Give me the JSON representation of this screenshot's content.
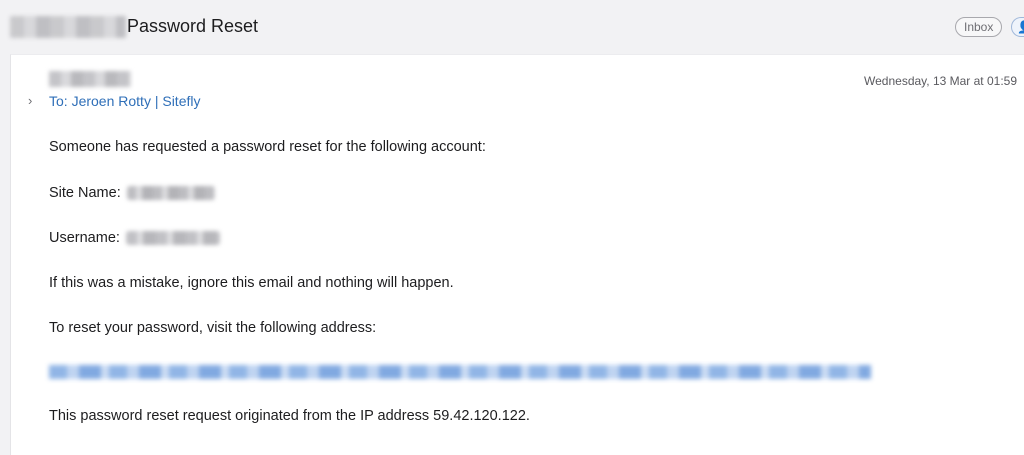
{
  "header": {
    "subject": "Password Reset",
    "mailbox_badge": "Inbox"
  },
  "message": {
    "to": "To: Jeroen Rotty | Sitefly",
    "date": "Wednesday, 13 Mar at 01:59",
    "body": {
      "intro": "Someone has requested a password reset for the following account:",
      "site_name_label": "Site Name:",
      "username_label": "Username:",
      "mistake": "If this was a mistake, ignore this email and nothing will happen.",
      "reset_instruction": "To reset your password, visit the following address:",
      "ip_notice": "This password reset request originated from the IP address 59.42.120.122."
    }
  },
  "icons": {
    "expand": "chevron-right-icon",
    "contact": "person-icon"
  }
}
